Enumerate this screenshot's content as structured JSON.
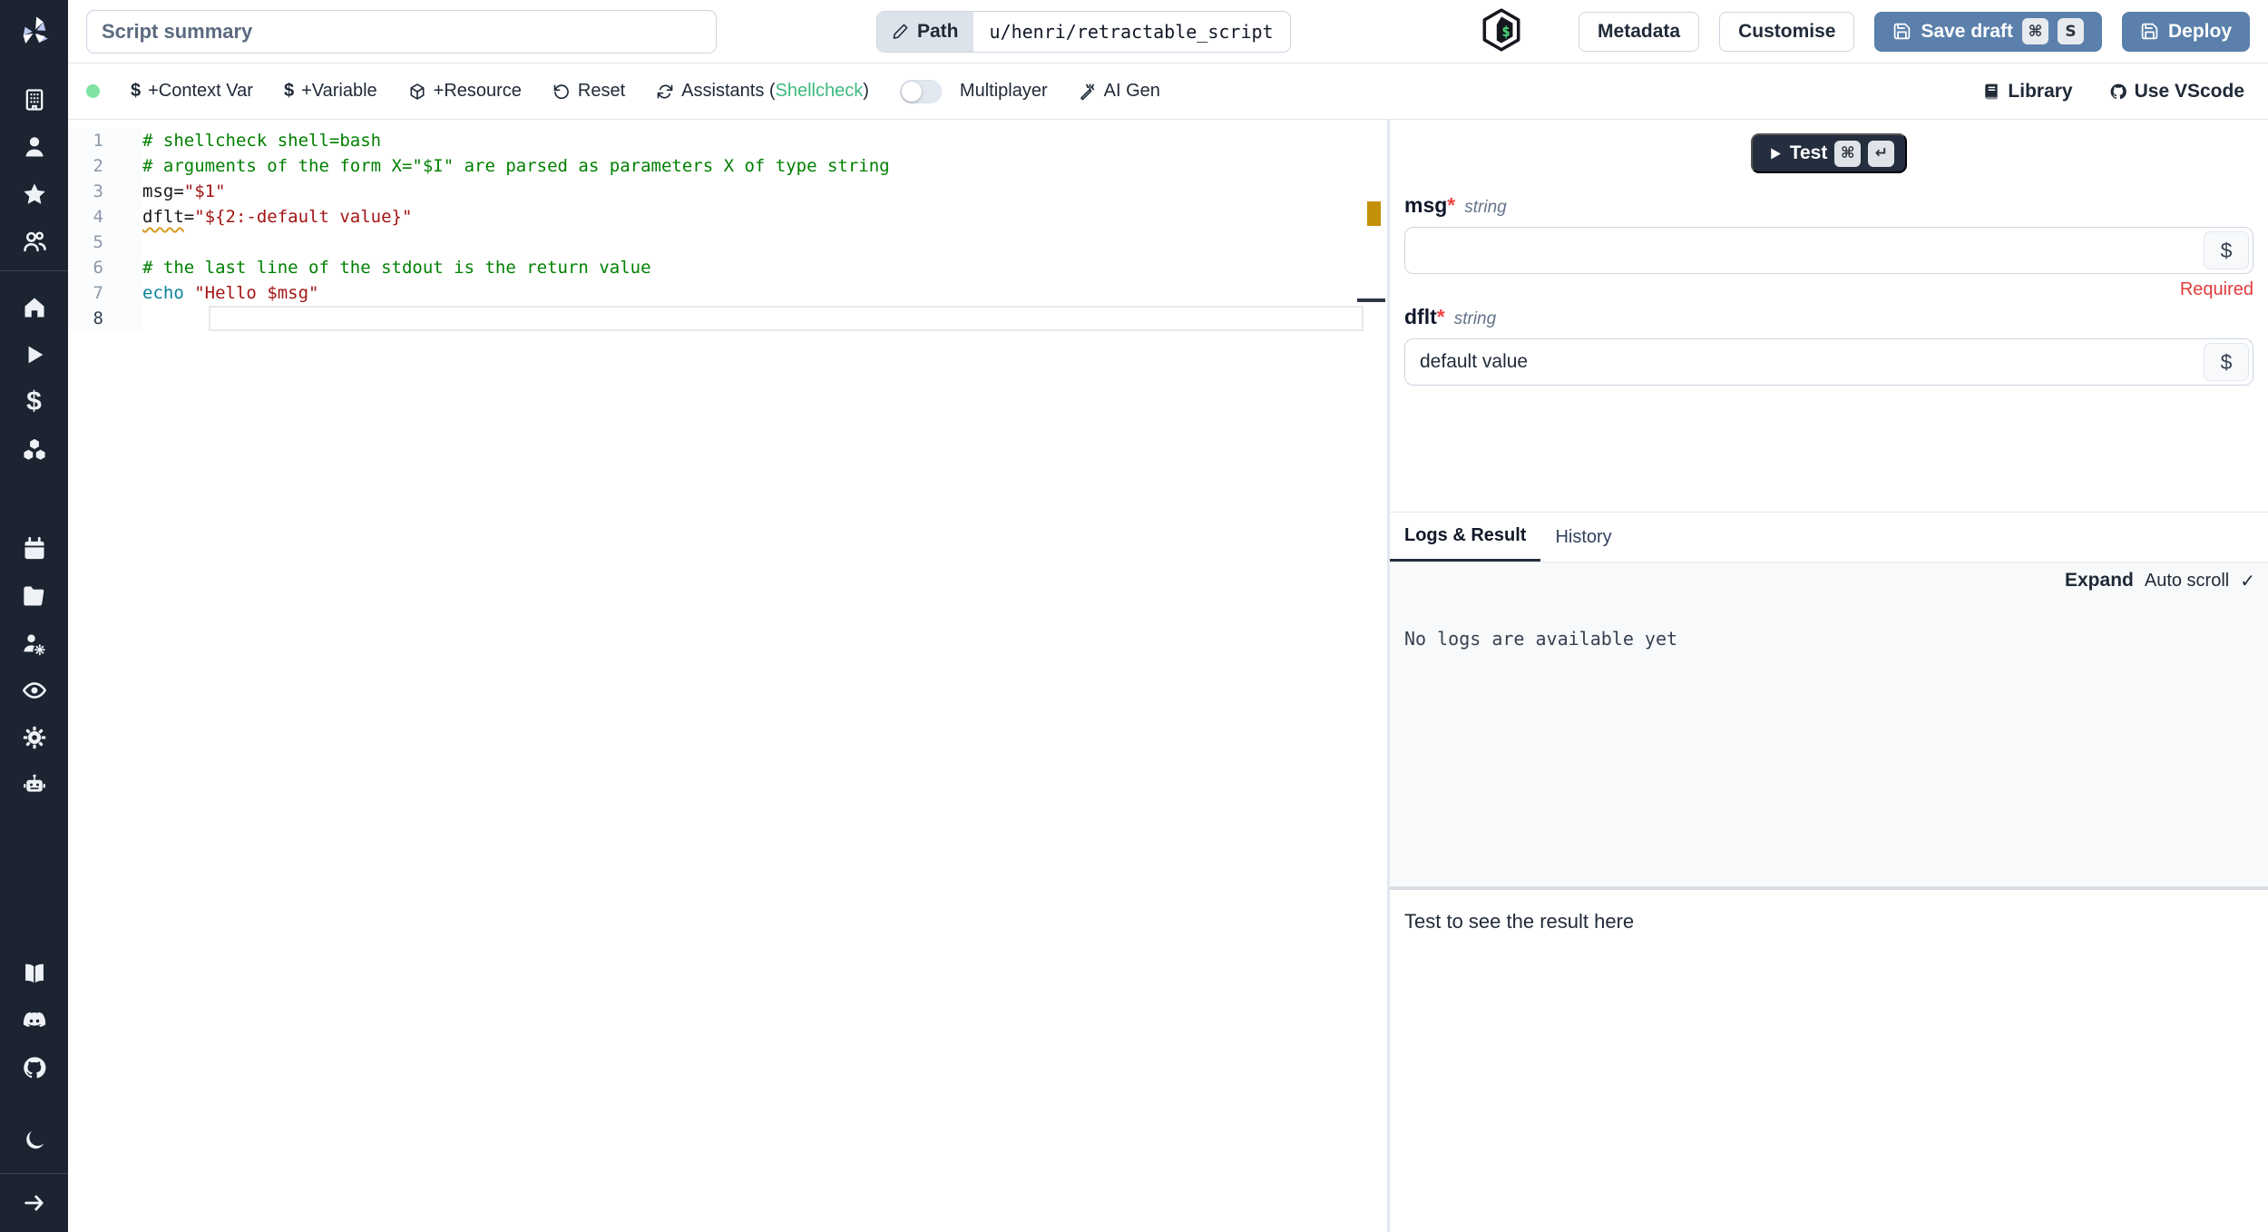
{
  "colors": {
    "sidebar_bg": "#1c2431",
    "accent_blue": "#5a80ab",
    "status_dot_green": "#7de2a3",
    "shellcheck_green": "#3dba7e",
    "warn_marker_amber": "#c49008",
    "comment_green": "#008000",
    "string_red": "#a31515",
    "keyword_teal": "#0c8298",
    "required_red": "#e13b3b"
  },
  "sidebar": {
    "icons": [
      "windmill-logo",
      "building-icon",
      "user-icon",
      "star-icon",
      "users-icon",
      "home-icon",
      "play-icon",
      "dollar-icon",
      "boxes-icon",
      "calendar-icon",
      "folder-icon",
      "users-cog-icon",
      "eye-icon",
      "gear-icon",
      "bot-icon",
      "book-icon",
      "discord-icon",
      "github-icon",
      "moon-icon",
      "arrow-right-icon"
    ]
  },
  "topbar": {
    "summary_placeholder": "Script summary",
    "path_label": "Path",
    "path_value": "u/henri/retractable_script",
    "metadata_label": "Metadata",
    "customise_label": "Customise",
    "save_draft_label": "Save draft",
    "save_kbd_cmd": "⌘",
    "save_kbd_key": "S",
    "deploy_label": "Deploy"
  },
  "toolbar": {
    "context_var_label": "+Context Var",
    "variable_label": "+Variable",
    "resource_label": "+Resource",
    "reset_label": "Reset",
    "assistants_prefix": "Assistants (",
    "assistants_link": "Shellcheck",
    "assistants_suffix": ")",
    "multiplayer_label": "Multiplayer",
    "ai_gen_label": "AI Gen",
    "dollar_glyph": "$",
    "library_label": "Library",
    "vscode_label": "Use VScode"
  },
  "editor": {
    "language": "bash",
    "lines": [
      {
        "no": "1",
        "active": false,
        "tokens": [
          {
            "t": "# shellcheck shell=bash",
            "c": "tk-comment"
          }
        ]
      },
      {
        "no": "2",
        "active": false,
        "tokens": [
          {
            "t": "# arguments of the form X=\"$I\" are parsed as parameters X of type string",
            "c": "tk-comment"
          }
        ]
      },
      {
        "no": "3",
        "active": false,
        "tokens": [
          {
            "t": "msg=",
            "c": "tk-plain"
          },
          {
            "t": "\"$1\"",
            "c": "tk-string"
          }
        ]
      },
      {
        "no": "4",
        "active": false,
        "tokens": [
          {
            "t": "dflt",
            "c": "tk-plain tk-warn"
          },
          {
            "t": "=",
            "c": "tk-plain"
          },
          {
            "t": "\"${2:-default value}\"",
            "c": "tk-string"
          }
        ]
      },
      {
        "no": "5",
        "active": false,
        "tokens": []
      },
      {
        "no": "6",
        "active": false,
        "tokens": [
          {
            "t": "# the last line of the stdout is the return value",
            "c": "tk-comment"
          }
        ]
      },
      {
        "no": "7",
        "active": false,
        "tokens": [
          {
            "t": "echo",
            "c": "tk-keyword"
          },
          {
            "t": " ",
            "c": "tk-plain"
          },
          {
            "t": "\"Hello $msg\"",
            "c": "tk-string"
          }
        ]
      },
      {
        "no": "8",
        "active": true,
        "tokens": []
      }
    ]
  },
  "right_panel": {
    "test_label": "Test",
    "test_kbd_cmd": "⌘",
    "test_kbd_enter": "↵",
    "dollar_button": "$",
    "fields": [
      {
        "name": "msg",
        "star": "*",
        "type": "string",
        "value": "",
        "error": "Required"
      },
      {
        "name": "dflt",
        "star": "*",
        "type": "string",
        "value": "default value",
        "error": ""
      }
    ],
    "tabs": {
      "logs": "Logs & Result",
      "history": "History"
    },
    "logs": {
      "expand": "Expand",
      "autoscroll": "Auto scroll",
      "check": "✓",
      "empty": "No logs are available yet"
    },
    "result_placeholder": "Test to see the result here"
  }
}
